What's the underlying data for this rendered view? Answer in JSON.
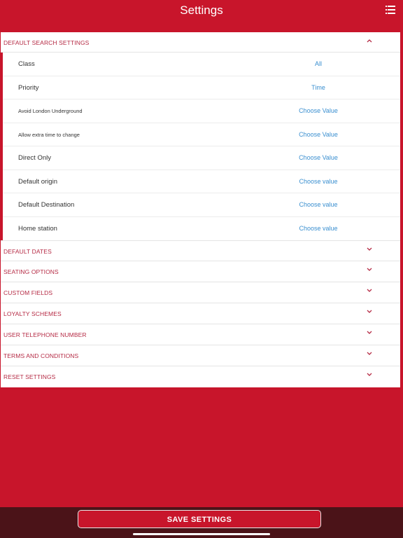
{
  "header": {
    "title": "Settings",
    "menu_icon": "list-icon"
  },
  "sections": [
    {
      "label": "DEFAULT SEARCH SETTINGS",
      "expanded": true,
      "items": [
        {
          "label": "Class",
          "value": "All"
        },
        {
          "label": "Priority",
          "value": "Time"
        },
        {
          "label": "Avoid London Underground",
          "value": "Choose Value"
        },
        {
          "label": "Allow extra time to change",
          "value": "Choose Value"
        },
        {
          "label": "Direct Only",
          "value": "Choose Value"
        },
        {
          "label": "Default origin",
          "value": "Choose value"
        },
        {
          "label": "Default Destination",
          "value": "Choose value"
        },
        {
          "label": "Home station",
          "value": "Choose value"
        }
      ]
    },
    {
      "label": "DEFAULT DATES",
      "expanded": false
    },
    {
      "label": "SEATING OPTIONS",
      "expanded": false
    },
    {
      "label": "CUSTOM FIELDS",
      "expanded": false
    },
    {
      "label": "LOYALTY SCHEMES",
      "expanded": false
    },
    {
      "label": "USER TELEPHONE NUMBER",
      "expanded": false
    },
    {
      "label": "TERMS AND CONDITIONS",
      "expanded": false
    },
    {
      "label": "RESET SETTINGS",
      "expanded": false
    }
  ],
  "footer": {
    "save_label": "SAVE SETTINGS"
  },
  "colors": {
    "brand": "#c8152b",
    "link": "#3a8fd0",
    "section_text": "#b52a44",
    "footer_bg": "#4b1318"
  }
}
